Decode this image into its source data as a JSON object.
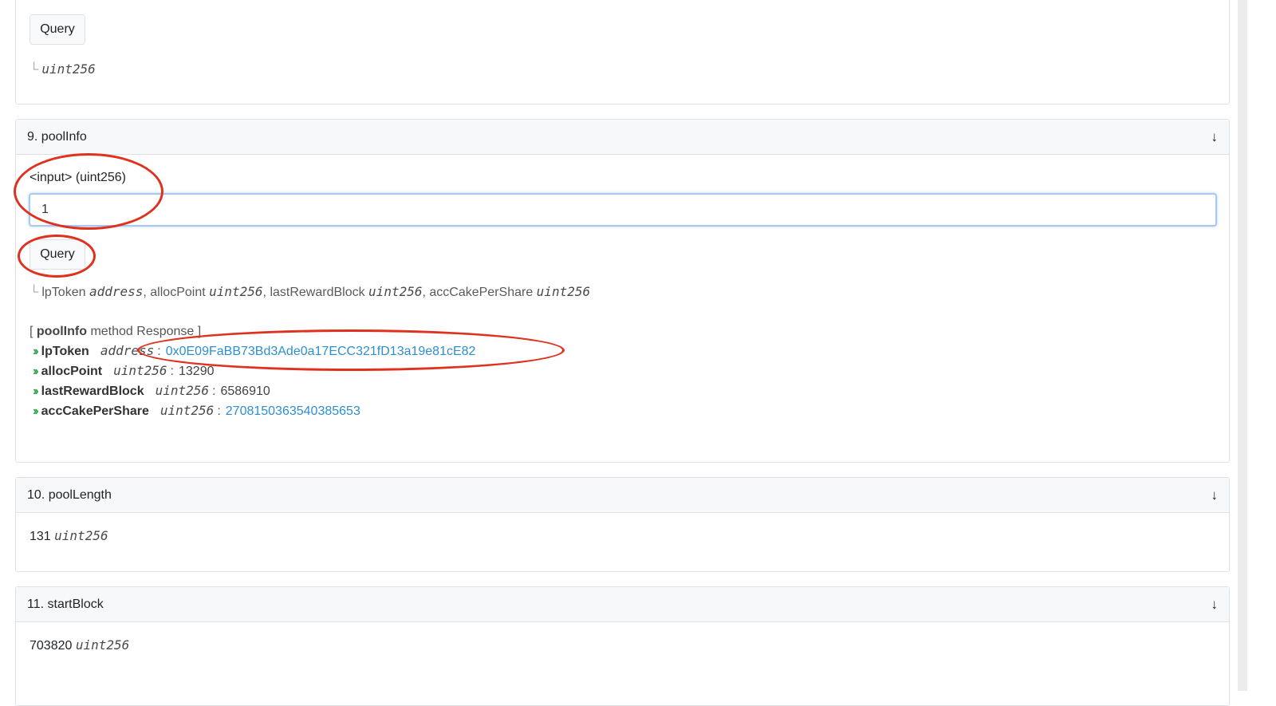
{
  "top_card": {
    "query_label": "Query",
    "return_type": "uint256"
  },
  "pool_info": {
    "header": "9. poolInfo",
    "input_label": "<input> (uint256)",
    "input_value": "1",
    "query_label": "Query",
    "returns": [
      {
        "name": "lpToken",
        "type": "address"
      },
      {
        "name": "allocPoint",
        "type": "uint256"
      },
      {
        "name": "lastRewardBlock",
        "type": "uint256"
      },
      {
        "name": "accCakePerShare",
        "type": "uint256"
      }
    ],
    "response": {
      "title_open": "[",
      "method": "poolInfo",
      "title_rest": "method Response ]",
      "rows": [
        {
          "name": "lpToken",
          "type": "address",
          "value": "0x0E09FaBB73Bd3Ade0a17ECC321fD13a19e81cE82",
          "is_link": true
        },
        {
          "name": "allocPoint",
          "type": "uint256",
          "value": "13290",
          "is_link": false
        },
        {
          "name": "lastRewardBlock",
          "type": "uint256",
          "value": "6586910",
          "is_link": false
        },
        {
          "name": "accCakePerShare",
          "type": "uint256",
          "value": "2708150363540385653",
          "is_link": true
        }
      ]
    }
  },
  "pool_length": {
    "header": "10. poolLength",
    "value": "131",
    "type": "uint256"
  },
  "start_block": {
    "header": "11. startBlock",
    "value": "703820",
    "type": "uint256"
  },
  "icons": {
    "collapse": "arrow-down-icon",
    "chevron": "double-chevron-right-icon"
  },
  "colors": {
    "annotation": "#e0301e",
    "link": "#2e8fcf",
    "chevron": "#28a745"
  }
}
